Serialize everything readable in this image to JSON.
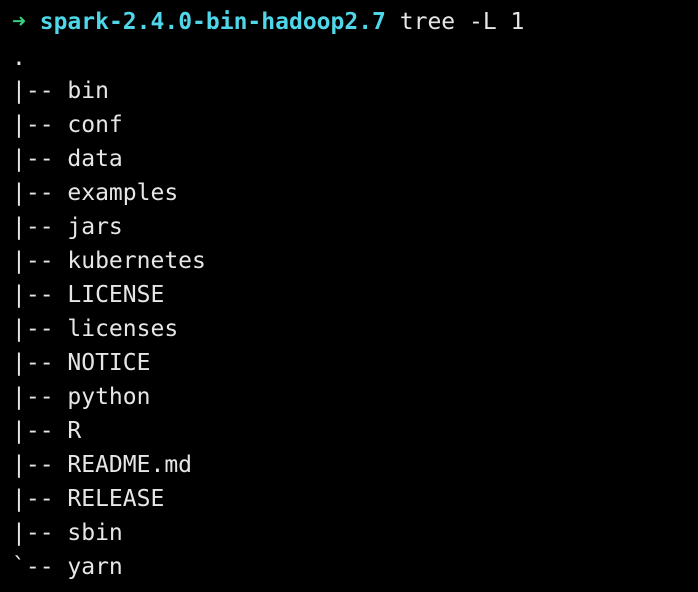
{
  "prompt": {
    "arrow": "➜",
    "cwd": "spark-2.4.0-bin-hadoop2.7",
    "command": "tree -L 1"
  },
  "tree": {
    "root": ".",
    "entries": [
      {
        "branch": "|-- ",
        "name": "bin"
      },
      {
        "branch": "|-- ",
        "name": "conf"
      },
      {
        "branch": "|-- ",
        "name": "data"
      },
      {
        "branch": "|-- ",
        "name": "examples"
      },
      {
        "branch": "|-- ",
        "name": "jars"
      },
      {
        "branch": "|-- ",
        "name": "kubernetes"
      },
      {
        "branch": "|-- ",
        "name": "LICENSE"
      },
      {
        "branch": "|-- ",
        "name": "licenses"
      },
      {
        "branch": "|-- ",
        "name": "NOTICE"
      },
      {
        "branch": "|-- ",
        "name": "python"
      },
      {
        "branch": "|-- ",
        "name": "R"
      },
      {
        "branch": "|-- ",
        "name": "README.md"
      },
      {
        "branch": "|-- ",
        "name": "RELEASE"
      },
      {
        "branch": "|-- ",
        "name": "sbin"
      },
      {
        "branch": "`-- ",
        "name": "yarn"
      }
    ]
  },
  "colors": {
    "background": "#000000",
    "arrow": "#35d07f",
    "cwd": "#4fd6e8",
    "text": "#e6e6e6"
  }
}
